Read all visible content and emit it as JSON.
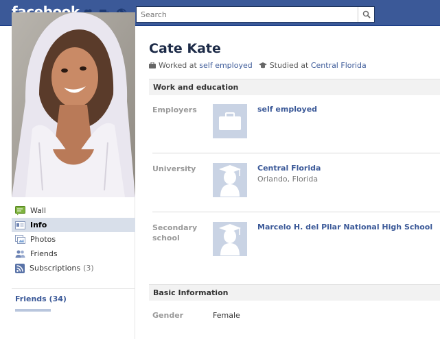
{
  "header": {
    "logo": "facebook",
    "search_placeholder": "Search"
  },
  "profile": {
    "name": "Cate Kate",
    "worked_prefix": "Worked at",
    "worked_link": "self employed",
    "studied_prefix": "Studied at",
    "studied_link": "Central Florida"
  },
  "sidebar": {
    "items": [
      {
        "label": "Wall",
        "icon": "wall-icon"
      },
      {
        "label": "Info",
        "icon": "info-icon",
        "active": true
      },
      {
        "label": "Photos",
        "icon": "photos-icon"
      },
      {
        "label": "Friends",
        "icon": "friends-icon"
      },
      {
        "label": "Subscriptions",
        "icon": "subscriptions-icon",
        "count": "(3)"
      }
    ],
    "friends_header": "Friends (34)"
  },
  "work_education": {
    "title": "Work and education",
    "rows": [
      {
        "label": "Employers",
        "title": "self employed",
        "sub": "",
        "icon": "briefcase-icon"
      },
      {
        "label": "University",
        "title": "Central Florida",
        "sub": "Orlando, Florida",
        "icon": "graduate-icon"
      },
      {
        "label": "Secondary school",
        "title": "Marcelo H. del Pilar National High School",
        "sub": "",
        "icon": "graduate-icon"
      }
    ]
  },
  "basic_info": {
    "title": "Basic Information",
    "gender_label": "Gender",
    "gender_value": "Female"
  },
  "colors": {
    "brand": "#3b5998",
    "nav_active": "#d8dfea",
    "thumb_bg": "#c9d3e4"
  }
}
